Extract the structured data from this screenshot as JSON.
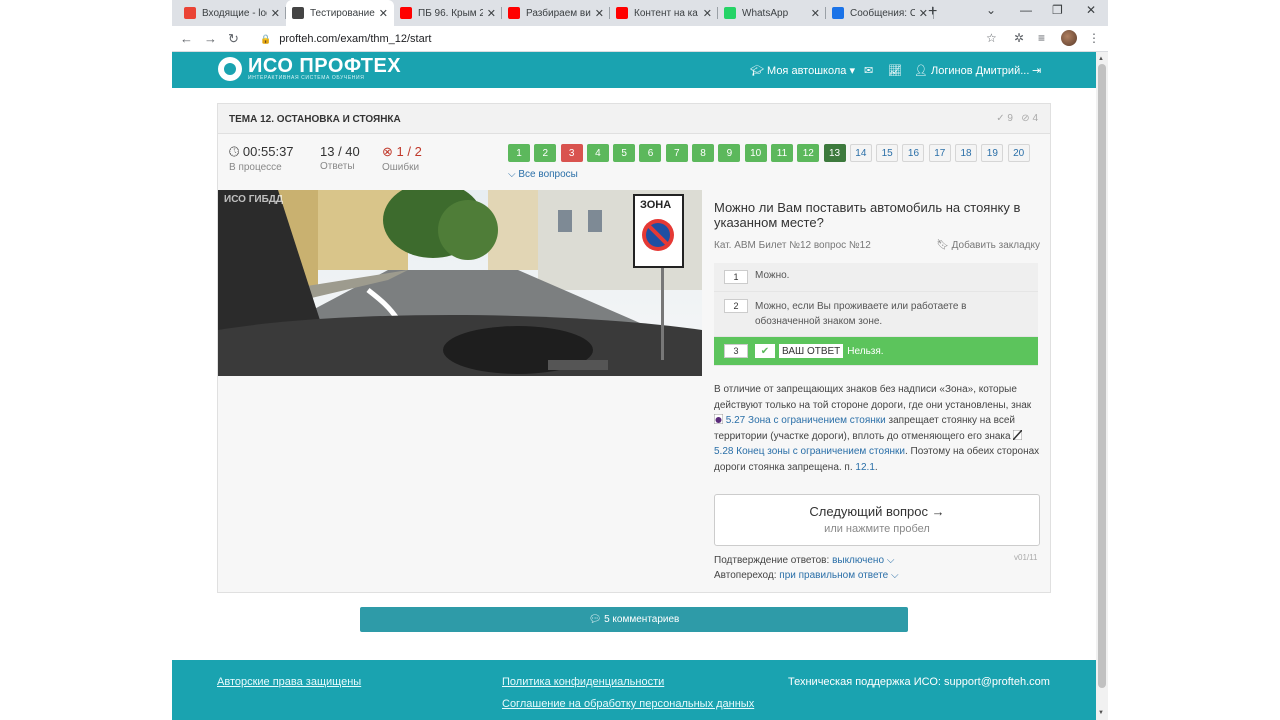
{
  "browser": {
    "tabs": [
      {
        "title": "Входящие - log",
        "icon": "gmail-icon",
        "color": "#ea4335"
      },
      {
        "title": "Тестирование",
        "icon": "iso-icon",
        "color": "#444444",
        "active": true
      },
      {
        "title": "ПБ 96. Крым 2",
        "icon": "youtube-icon",
        "color": "#ff0000"
      },
      {
        "title": "Разбираем ви",
        "icon": "youtube-icon",
        "color": "#ff0000"
      },
      {
        "title": "Контент на ка",
        "icon": "youtube-icon",
        "color": "#ff0000"
      },
      {
        "title": "WhatsApp",
        "icon": "whatsapp-icon",
        "color": "#25d366"
      },
      {
        "title": "Сообщения: C",
        "icon": "messages-icon",
        "color": "#1a73e8"
      }
    ],
    "url": "profteh.com/exam/thm_12/start"
  },
  "header": {
    "logo_name": "ИСО ПРОФТЕХ",
    "logo_sub": "ИНТЕРАКТИВНАЯ СИСТЕМА ОБУЧЕНИЯ",
    "school": "Моя автошкола",
    "user": "Логинов Дмитрий..."
  },
  "exam": {
    "topic": "ТЕМА 12. ОСТАНОВКА И СТОЯНКА",
    "count_ok": "9",
    "count_skip": "4",
    "time": "00:55:37",
    "time_label": "В процессе",
    "answers": "13 / 40",
    "answers_label": "Ответы",
    "errors": "1 / 2",
    "errors_label": "Ошибки",
    "all_questions": "Все вопросы",
    "numbers": [
      {
        "n": "1",
        "s": "ok"
      },
      {
        "n": "2",
        "s": "ok"
      },
      {
        "n": "3",
        "s": "err"
      },
      {
        "n": "4",
        "s": "ok"
      },
      {
        "n": "5",
        "s": "ok"
      },
      {
        "n": "6",
        "s": "ok"
      },
      {
        "n": "7",
        "s": "ok"
      },
      {
        "n": "8",
        "s": "ok"
      },
      {
        "n": "9",
        "s": "ok"
      },
      {
        "n": "10",
        "s": "ok"
      },
      {
        "n": "11",
        "s": "ok"
      },
      {
        "n": "12",
        "s": "ok"
      },
      {
        "n": "13",
        "s": "cur"
      },
      {
        "n": "14",
        "s": "pend"
      },
      {
        "n": "15",
        "s": "pend"
      },
      {
        "n": "16",
        "s": "pend"
      },
      {
        "n": "17",
        "s": "pend"
      },
      {
        "n": "18",
        "s": "pend"
      },
      {
        "n": "19",
        "s": "pend"
      },
      {
        "n": "20",
        "s": "pend"
      }
    ]
  },
  "photo": {
    "watermark": "ИСО  ГИБДД",
    "sign_text": "ЗОНА"
  },
  "question": {
    "text": "Можно ли Вам поставить автомобиль на стоянку в указанном месте?",
    "meta": "Кат. ABM  Билет №12  вопрос №12",
    "bookmark": "Добавить закладку",
    "options": [
      {
        "num": "1",
        "text": "Можно."
      },
      {
        "num": "2",
        "text": "Можно, если Вы проживаете или работаете в обозначенной знаком зоне."
      },
      {
        "num": "3",
        "text": "Нельзя.",
        "your_label": "ВАШ ОТВЕТ"
      }
    ]
  },
  "explanation": {
    "p1": "В отличие от запрещающих знаков без надписи «Зона», которые действуют только на той стороне дороги, где они установлены, знак",
    "link1": "5.27 Зона с ограничением стоянки",
    "p2": "запрещает стоянку на всей территории (участке дороги), вплоть до отменяющего его знака",
    "link2": "5.28 Конец зоны с ограничением стоянки",
    "p3": ". Поэтому на обеих сторонах дороги стоянка запрещена. п.",
    "link3": "12.1",
    "p4": "."
  },
  "next": {
    "title": "Следующий вопрос →",
    "hint": "или нажмите пробел"
  },
  "options_settings": {
    "confirm_label": "Подтверждение ответов:",
    "confirm_value": "выключено",
    "auto_label": "Автопереход:",
    "auto_value": "при правильном ответе",
    "version": "v01/11"
  },
  "comments": "5 комментариев",
  "footer": {
    "copyright": "Авторские права защищены",
    "privacy": "Политика конфиденциальности",
    "consent": "Соглашение на обработку персональных данных",
    "support": "Техническая поддержка ИСО:  support@profteh.com"
  }
}
